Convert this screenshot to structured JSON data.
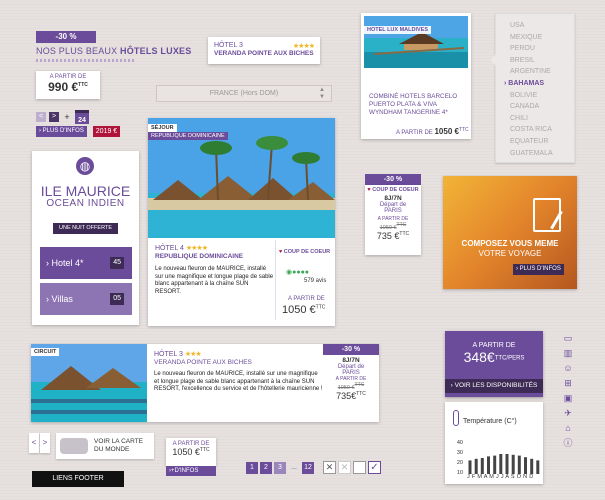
{
  "badge_top": {
    "discount": "-30 %",
    "title_a": "NOS PLUS BEAUX ",
    "title_b": "HÔTELS LUXES"
  },
  "price_box_1": {
    "label": "A PARTIR DE",
    "price": "990 €",
    "sup": "TTC"
  },
  "nav_small": {
    "prev": "<",
    "next": ">",
    "add": "+",
    "calendar_day": "24",
    "more_info": "PLUS D'INFOS",
    "price_tag": "2019 €"
  },
  "hotel_card_1": {
    "name": "HÔTEL 3",
    "stars": "★★★★",
    "subtitle": "VERANDA POINTE AUX BICHES"
  },
  "dropdown_france": {
    "value": "FRANCE (Hors DOM)"
  },
  "maldives": {
    "tag": "HOTEL LUX MALDIVES",
    "desc": "COMBINÉ HOTELS BARCELO PUERTO PLATA & VIVA WYNDHAM TANGERINE 4*",
    "from": "A PARTIR DE",
    "price": "1050 €",
    "sup": "TTC"
  },
  "country_list": {
    "items": [
      "USA",
      "MEXIQUE",
      "PEROU",
      "BRESIL",
      "ARGENTINE",
      "BAHAMAS",
      "BOLIVIE",
      "CANADA",
      "CHILI",
      "COSTA RICA",
      "EQUATEUR",
      "GUATEMALA"
    ],
    "selected": "BAHAMAS"
  },
  "ile_maurice": {
    "title": "ILE MAURICE",
    "subtitle": "OCEAN INDIEN",
    "offer": "UNE NUIT OFFERTE",
    "rows": [
      {
        "label": "Hotel 4*",
        "count": "45"
      },
      {
        "label": "Villas",
        "count": "05"
      }
    ]
  },
  "sejour_card": {
    "tag": "SÉJOUR",
    "location": "REPUBLIQUE DOMINICAINE",
    "hotel": "HÔTEL 4",
    "stars": "★★★★",
    "region": "REPUBLIQUE DOMINICAINE",
    "coup": "COUP DE COEUR",
    "reviews": "579 avis",
    "desc": "Le nouveau fleuron de MAURICE, installé sur une magnifique et longue plage de sable blanc appartenant à la chaîne SUN RESORT.",
    "from": "A PARTIR DE",
    "price": "1050 €",
    "sup": "TTC"
  },
  "coup_small": {
    "discount": "-30 %",
    "coup": "COUP DE COEUR",
    "duration": "8J/7N",
    "depart": "Départ de",
    "city": "PARIS",
    "from": "A PARTIR DE",
    "old_price": "1050 €",
    "old_sup": "TTC",
    "price": "735 €",
    "sup": "TTC"
  },
  "compose": {
    "line1": "COMPOSEZ VOUS MEME",
    "line2": "VOTRE VOYAGE",
    "btn": "PLUS D'INFOS"
  },
  "circuit": {
    "tag": "CIRCUIT",
    "hotel": "HÔTEL 3",
    "stars": "★★★",
    "name": "VERANDA POINTE AUX BICHES",
    "desc": "Le nouveau fleuron de MAURICE, installé sur une magnifique et longue plage de sable blanc appartenant à la chaîne SUN RESORT, l'excellence du service et de l'hôtellerie mauricienne !",
    "discount": "-30 %",
    "duration": "8J/7N",
    "depart": "Départ de",
    "city": "PARIS",
    "from": "A PARTIR DE",
    "old_price": "1050 €",
    "old_sup": "TTC",
    "price": "735€",
    "sup": "TTC"
  },
  "dispo": {
    "from": "A PARTIR DE",
    "price": "348€",
    "unit": "TTC/PERS",
    "btn": "VOIR LES DISPONIBILITÉS"
  },
  "temperature": {
    "title": "Température (C°)",
    "months": "J F M A M J J A S O N D",
    "yticks": [
      "40",
      "30",
      "20",
      "10"
    ],
    "chart_data": {
      "type": "bar",
      "categories": [
        "J",
        "F",
        "M",
        "A",
        "M",
        "J",
        "J",
        "A",
        "S",
        "O",
        "N",
        "D"
      ],
      "values": [
        17,
        19,
        20,
        22,
        23,
        25,
        25,
        24,
        23,
        21,
        19,
        17
      ],
      "ylim": [
        0,
        45
      ]
    }
  },
  "map_btn": {
    "prev": "<",
    "next": ">",
    "label1": "VOIR LA CARTE",
    "label2": "DU MONDE"
  },
  "bottom_price": {
    "label": "A PARTIR DE",
    "price": "1050 €",
    "sup": "TTC",
    "btn": "D'INFOS"
  },
  "pagination": {
    "pages": [
      "1",
      "2",
      "3",
      "...",
      "12"
    ]
  },
  "footer_btn": {
    "label": "LIENS FOOTER"
  }
}
